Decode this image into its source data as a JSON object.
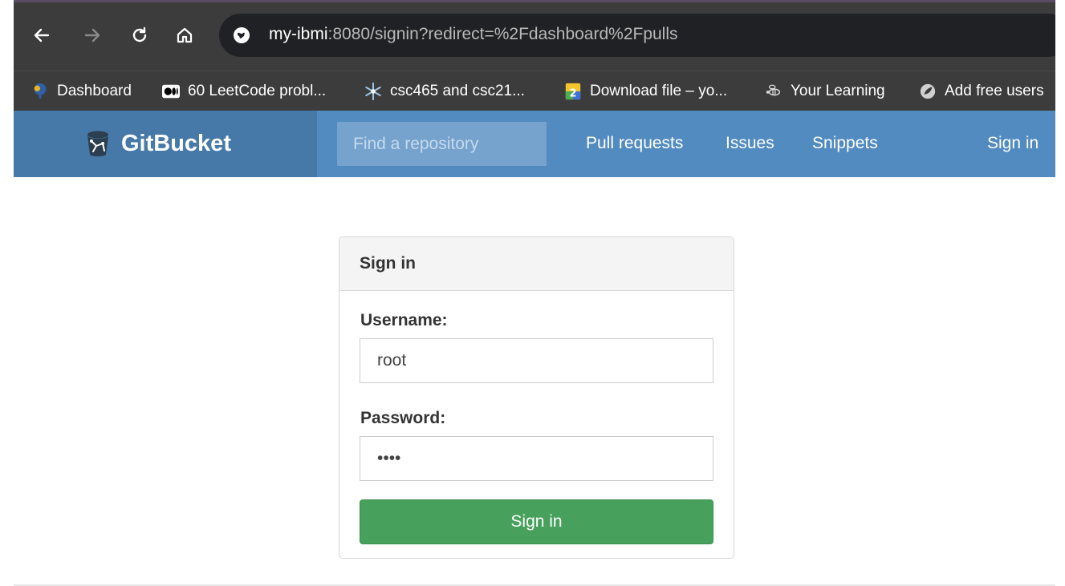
{
  "browser": {
    "url_host": "my-ibmi",
    "url_rest": ":8080/signin?redirect=%2Fdashboard%2Fpulls",
    "bookmarks": [
      {
        "label": "Dashboard",
        "icon": "tree-icon"
      },
      {
        "label": "60 LeetCode probl...",
        "icon": "medium-icon"
      },
      {
        "label": "csc465 and csc21...",
        "icon": "snowflake-icon"
      },
      {
        "label": "Download file – yo...",
        "icon": "number-2-icon"
      },
      {
        "label": "Your Learning",
        "icon": "bee-icon"
      },
      {
        "label": "Add free users",
        "icon": "leaf-icon"
      }
    ]
  },
  "navbar": {
    "brand": "GitBucket",
    "search_placeholder": "Find a repository",
    "links": [
      "Pull requests",
      "Issues",
      "Snippets"
    ],
    "signin": "Sign in"
  },
  "signin_form": {
    "title": "Sign in",
    "username_label": "Username:",
    "username_value": "root",
    "password_label": "Password:",
    "password_value": "root",
    "submit_label": "Sign in"
  },
  "colors": {
    "navbar": "#528bbf",
    "brand_area": "#4679a8",
    "submit": "#47a15c",
    "browser_chrome": "#3c3c3c"
  }
}
